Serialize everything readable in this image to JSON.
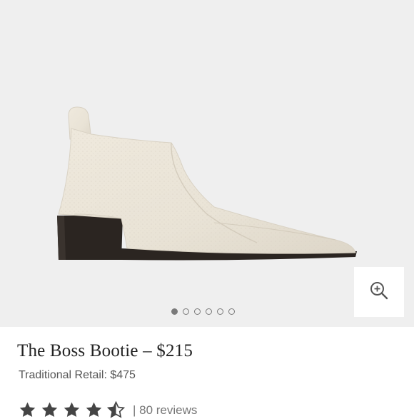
{
  "product": {
    "title": "The Boss Bootie – $215",
    "retail": "Traditional Retail: $475",
    "rating": 4.5,
    "rating_max": 5,
    "reviews": "| 80 reviews"
  },
  "gallery": {
    "image_count": 6,
    "active_index": 0,
    "zoom_icon": "zoom-in-icon"
  },
  "colors": {
    "background": "#efefef",
    "leather": "#ebe5d9",
    "heel": "#2a2420",
    "star": "#444444"
  }
}
